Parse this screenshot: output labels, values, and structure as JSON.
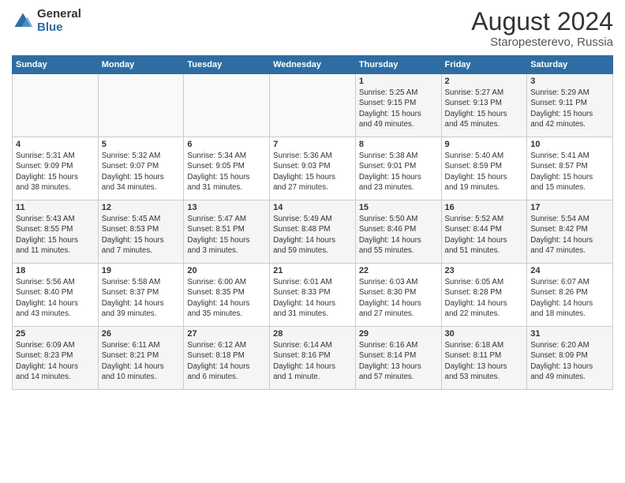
{
  "header": {
    "logo_general": "General",
    "logo_blue": "Blue",
    "month_year": "August 2024",
    "location": "Staropesterevo, Russia"
  },
  "weekdays": [
    "Sunday",
    "Monday",
    "Tuesday",
    "Wednesday",
    "Thursday",
    "Friday",
    "Saturday"
  ],
  "weeks": [
    [
      {
        "day": "",
        "info": ""
      },
      {
        "day": "",
        "info": ""
      },
      {
        "day": "",
        "info": ""
      },
      {
        "day": "",
        "info": ""
      },
      {
        "day": "1",
        "info": "Sunrise: 5:25 AM\nSunset: 9:15 PM\nDaylight: 15 hours\nand 49 minutes."
      },
      {
        "day": "2",
        "info": "Sunrise: 5:27 AM\nSunset: 9:13 PM\nDaylight: 15 hours\nand 45 minutes."
      },
      {
        "day": "3",
        "info": "Sunrise: 5:29 AM\nSunset: 9:11 PM\nDaylight: 15 hours\nand 42 minutes."
      }
    ],
    [
      {
        "day": "4",
        "info": "Sunrise: 5:31 AM\nSunset: 9:09 PM\nDaylight: 15 hours\nand 38 minutes."
      },
      {
        "day": "5",
        "info": "Sunrise: 5:32 AM\nSunset: 9:07 PM\nDaylight: 15 hours\nand 34 minutes."
      },
      {
        "day": "6",
        "info": "Sunrise: 5:34 AM\nSunset: 9:05 PM\nDaylight: 15 hours\nand 31 minutes."
      },
      {
        "day": "7",
        "info": "Sunrise: 5:36 AM\nSunset: 9:03 PM\nDaylight: 15 hours\nand 27 minutes."
      },
      {
        "day": "8",
        "info": "Sunrise: 5:38 AM\nSunset: 9:01 PM\nDaylight: 15 hours\nand 23 minutes."
      },
      {
        "day": "9",
        "info": "Sunrise: 5:40 AM\nSunset: 8:59 PM\nDaylight: 15 hours\nand 19 minutes."
      },
      {
        "day": "10",
        "info": "Sunrise: 5:41 AM\nSunset: 8:57 PM\nDaylight: 15 hours\nand 15 minutes."
      }
    ],
    [
      {
        "day": "11",
        "info": "Sunrise: 5:43 AM\nSunset: 8:55 PM\nDaylight: 15 hours\nand 11 minutes."
      },
      {
        "day": "12",
        "info": "Sunrise: 5:45 AM\nSunset: 8:53 PM\nDaylight: 15 hours\nand 7 minutes."
      },
      {
        "day": "13",
        "info": "Sunrise: 5:47 AM\nSunset: 8:51 PM\nDaylight: 15 hours\nand 3 minutes."
      },
      {
        "day": "14",
        "info": "Sunrise: 5:49 AM\nSunset: 8:48 PM\nDaylight: 14 hours\nand 59 minutes."
      },
      {
        "day": "15",
        "info": "Sunrise: 5:50 AM\nSunset: 8:46 PM\nDaylight: 14 hours\nand 55 minutes."
      },
      {
        "day": "16",
        "info": "Sunrise: 5:52 AM\nSunset: 8:44 PM\nDaylight: 14 hours\nand 51 minutes."
      },
      {
        "day": "17",
        "info": "Sunrise: 5:54 AM\nSunset: 8:42 PM\nDaylight: 14 hours\nand 47 minutes."
      }
    ],
    [
      {
        "day": "18",
        "info": "Sunrise: 5:56 AM\nSunset: 8:40 PM\nDaylight: 14 hours\nand 43 minutes."
      },
      {
        "day": "19",
        "info": "Sunrise: 5:58 AM\nSunset: 8:37 PM\nDaylight: 14 hours\nand 39 minutes."
      },
      {
        "day": "20",
        "info": "Sunrise: 6:00 AM\nSunset: 8:35 PM\nDaylight: 14 hours\nand 35 minutes."
      },
      {
        "day": "21",
        "info": "Sunrise: 6:01 AM\nSunset: 8:33 PM\nDaylight: 14 hours\nand 31 minutes."
      },
      {
        "day": "22",
        "info": "Sunrise: 6:03 AM\nSunset: 8:30 PM\nDaylight: 14 hours\nand 27 minutes."
      },
      {
        "day": "23",
        "info": "Sunrise: 6:05 AM\nSunset: 8:28 PM\nDaylight: 14 hours\nand 22 minutes."
      },
      {
        "day": "24",
        "info": "Sunrise: 6:07 AM\nSunset: 8:26 PM\nDaylight: 14 hours\nand 18 minutes."
      }
    ],
    [
      {
        "day": "25",
        "info": "Sunrise: 6:09 AM\nSunset: 8:23 PM\nDaylight: 14 hours\nand 14 minutes."
      },
      {
        "day": "26",
        "info": "Sunrise: 6:11 AM\nSunset: 8:21 PM\nDaylight: 14 hours\nand 10 minutes."
      },
      {
        "day": "27",
        "info": "Sunrise: 6:12 AM\nSunset: 8:18 PM\nDaylight: 14 hours\nand 6 minutes."
      },
      {
        "day": "28",
        "info": "Sunrise: 6:14 AM\nSunset: 8:16 PM\nDaylight: 14 hours\nand 1 minute."
      },
      {
        "day": "29",
        "info": "Sunrise: 6:16 AM\nSunset: 8:14 PM\nDaylight: 13 hours\nand 57 minutes."
      },
      {
        "day": "30",
        "info": "Sunrise: 6:18 AM\nSunset: 8:11 PM\nDaylight: 13 hours\nand 53 minutes."
      },
      {
        "day": "31",
        "info": "Sunrise: 6:20 AM\nSunset: 8:09 PM\nDaylight: 13 hours\nand 49 minutes."
      }
    ]
  ]
}
